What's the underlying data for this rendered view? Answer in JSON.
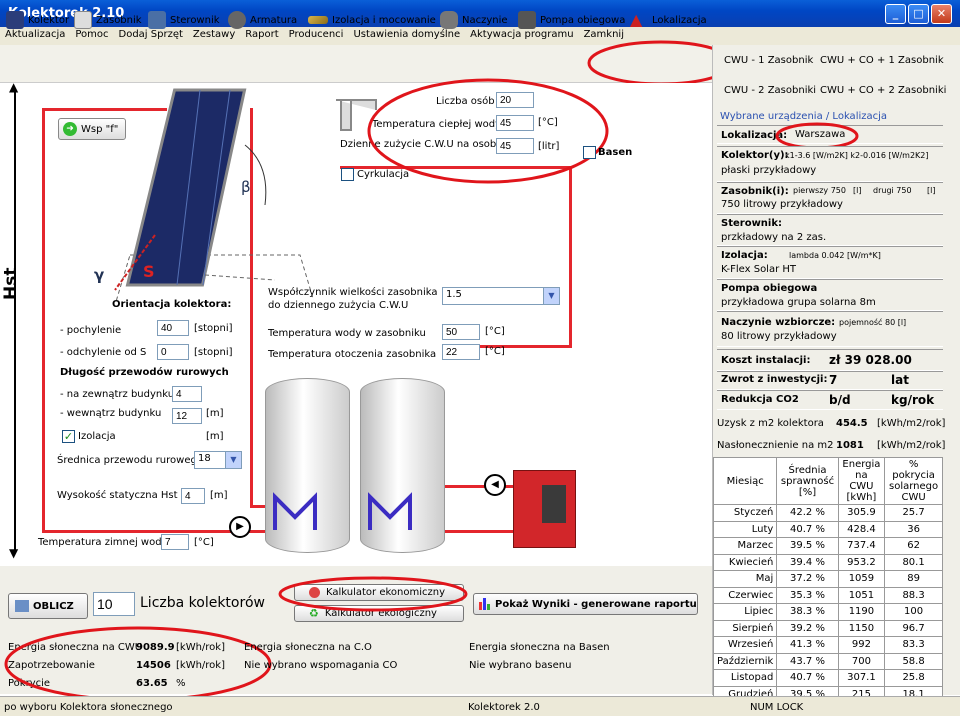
{
  "window": {
    "title": "Kolektorek 2.10",
    "minimize": "_",
    "maximize": "□",
    "close": "✕"
  },
  "menu": [
    "Aktualizacja",
    "Pomoc",
    "Dodaj Sprzęt",
    "Zestawy",
    "Raport",
    "Producenci",
    "Ustawienia domyślne",
    "Aktywacja programu",
    "Zamknij"
  ],
  "toolbar": [
    "Kolektor",
    "Zasobnik",
    "Sterownik",
    "Armatura",
    "Izolacja i mocowanie",
    "Naczynie",
    "Pompa obiegowa",
    "Lokalizacja"
  ],
  "configs": [
    "CWU - 1 Zasobnik",
    "CWU + CO + 1 Zasobnik",
    "CWU - 2 Zasobniki",
    "CWU + CO + 2 Zasobniki"
  ],
  "selected": {
    "header": "Wybrane urządzenia / Lokalizacja",
    "location_label": "Lokalizacja:",
    "location": "Warszawa",
    "collector_label": "Kolektor(y):",
    "collector_params": "k1-3.6 [W/m2K] k2-0.016 [W/m2K2]",
    "collector_name": "płaski przykładowy",
    "tank_label": "Zasobnik(i):",
    "tank_first": "pierwszy 750",
    "tank_unit1": "[l]",
    "tank_second": "drugi 750",
    "tank_unit2": "[l]",
    "tank_name": "750 litrowy przykładowy",
    "controller_label": "Sterownik:",
    "controller_name": "przkładowy na 2 zas.",
    "insulation_label": "Izolacja:",
    "insulation_params": "lambda 0.042 [W/m*K]",
    "insulation_name": "K-Flex Solar HT",
    "pump_label": "Pompa obiegowa",
    "pump_name": "przykładowa grupa solarna 8m",
    "vessel_label": "Naczynie wzbiorcze:",
    "vessel_params": "pojemność 80 [l]",
    "vessel_name": "80 litrowy przykładowy",
    "cost_label": "Koszt instalacji:",
    "cost": "zł 39 028.00",
    "roi_label": "Zwrot z inwestycji:",
    "roi": "7",
    "roi_unit": "lat",
    "co2_label": "Redukcja CO2",
    "co2_value": "b/d",
    "co2_unit": "kg/rok",
    "yield_label": "Uzysk z m2 kolektora",
    "yield": "454.5",
    "yield_unit": "[kWh/m2/rok]",
    "insol_label": "Nasłonecznienie na m2",
    "insol": "1081",
    "insol_unit": "[kWh/m2/rok]"
  },
  "months_table": {
    "headers": [
      "Miesiąc",
      "Średnia sprawność [%]",
      "Energia na CWU [kWh]",
      "% pokrycia solarnego CWU"
    ],
    "rows": [
      [
        "Styczeń",
        "42.2 %",
        "305.9",
        "25.7"
      ],
      [
        "Luty",
        "40.7 %",
        "428.4",
        "36"
      ],
      [
        "Marzec",
        "39.5 %",
        "737.4",
        "62"
      ],
      [
        "Kwiecień",
        "39.4 %",
        "953.2",
        "80.1"
      ],
      [
        "Maj",
        "37.2 %",
        "1059",
        "89"
      ],
      [
        "Czerwiec",
        "35.3 %",
        "1051",
        "88.3"
      ],
      [
        "Lipiec",
        "38.3 %",
        "1190",
        "100"
      ],
      [
        "Sierpień",
        "39.2 %",
        "1150",
        "96.7"
      ],
      [
        "Wrzesień",
        "41.3 %",
        "992",
        "83.3"
      ],
      [
        "Październik",
        "43.7 %",
        "700",
        "58.8"
      ],
      [
        "Listopad",
        "40.7 %",
        "307.1",
        "25.8"
      ],
      [
        "Grudzień",
        "39.5 %",
        "215",
        "18.1"
      ]
    ]
  },
  "diagram": {
    "hst": "Hst",
    "wsp_button": "Wsp \"f\"",
    "beta": "β",
    "gamma": "γ",
    "south": "S",
    "orientation_title": "Orientacja kolektora:",
    "tilt_label": "- pochylenie",
    "tilt": "40",
    "tilt_unit": "[stopni]",
    "deviation_label": "- odchylenie od S",
    "deviation": "0",
    "deviation_unit": "[stopni]",
    "pipe_title": "Długość przewodów rurowych",
    "outside_label": "- na zewnątrz budynku",
    "outside": "4",
    "inside_label": "- wewnątrz budynku",
    "inside": "12",
    "inside_unit": "[m]",
    "insulation_chk": "Izolacja",
    "insulation_unit": "[m]",
    "diameter_label": "Średnica przewodu rurowego",
    "diameter": "18",
    "static_label": "Wysokość statyczna Hst",
    "static": "4",
    "static_unit": "[m]",
    "cold_label": "Temperatura zimnej wody",
    "cold": "7",
    "cold_unit": "[°C]",
    "persons_label": "Liczba osób",
    "persons": "20",
    "hotwater_label": "Temperatura ciepłej wody",
    "hotwater": "45",
    "hotwater_unit": "[°C]",
    "daily_label": "Dzienne zużycie C.W.U na osobę",
    "daily": "45",
    "daily_unit": "[litr]",
    "basen": "Basen",
    "cyrkulacja": "Cyrkulacja",
    "coef_label1": "Współczynnik wielkości zasobnika",
    "coef_label2": "do dziennego zużycia C.W.U",
    "coef": "1.5",
    "tank_temp_label": "Temperatura wody w zasobniku",
    "tank_temp": "50",
    "tank_temp_unit": "[°C]",
    "amb_temp_label": "Temperatura otoczenia zasobnika",
    "amb_temp": "22",
    "amb_temp_unit": "[°C]"
  },
  "bottom": {
    "oblicz": "OBLICZ",
    "collectors_count": "10",
    "collectors_label": "Liczba kolektorów",
    "calc_econ": "Kalkulator ekonomiczny",
    "calc_eco": "Kalkulator ekologiczny",
    "report_btn": "Pokaż Wyniki - generowane raportu",
    "e_cwu_label": "Energia słoneczna na CWU",
    "e_cwu": "9089.9",
    "e_cwu_unit": "[kWh/rok]",
    "demand_label": "Zapotrzebowanie",
    "demand": "14506",
    "demand_unit": "[kWh/rok]",
    "cover_label": "Pokrycie",
    "cover": "63.65",
    "cover_unit": "%",
    "e_co_label": "Energia słoneczna na C.O",
    "e_co_note": "Nie wybrano wspomagania CO",
    "e_pool_label": "Energia słoneczna na Basen",
    "e_pool_note": "Nie wybrano basenu"
  },
  "status": {
    "left": "po wyboru Kolektora słonecznego",
    "mid": "Kolektorek 2.0",
    "right": "NUM LOCK"
  }
}
